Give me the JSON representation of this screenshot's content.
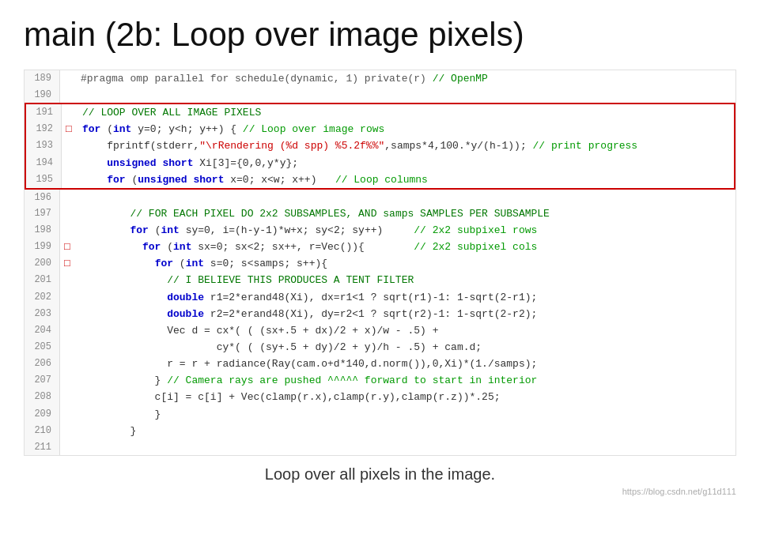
{
  "title": "main (2b: Loop over image pixels)",
  "lines": [
    {
      "num": "189",
      "marker": "",
      "content": "<span class='pragma'>#pragma omp parallel for schedule(dynamic, 1) private(r) // OpenMP</span>"
    },
    {
      "num": "190",
      "marker": "",
      "content": ""
    },
    {
      "num": "191",
      "marker": "",
      "content": "<span class='cap-comment'>// LOOP OVER ALL IMAGE PIXELS</span>",
      "boxTop": true
    },
    {
      "num": "192",
      "marker": "□",
      "content": "<span class='kw'>for</span> <span class='plain'>(</span><span class='kw'>int</span> <span class='plain'>y=0; y&lt;h; y++)</span> <span class='plain'>{ </span><span class='comment'>// Loop over image rows</span>"
    },
    {
      "num": "193",
      "marker": "",
      "content": "    <span class='plain'>fprintf(stderr,</span><span class='string'>&quot;\\rRendering (%d spp) %5.2f%%&quot;</span><span class='plain'>,samps*4,100.*y/(h-1)); </span><span class='comment'>// print progress</span>"
    },
    {
      "num": "194",
      "marker": "",
      "content": "    <span class='unsigned-kw'>unsigned short</span> <span class='plain'>Xi[3]={0,0,y*y};</span>"
    },
    {
      "num": "195",
      "marker": "",
      "content": "    <span class='kw'>for</span> <span class='plain'>(</span><span class='unsigned-kw'>unsigned short</span> <span class='plain'>x=0; x&lt;w; x++)</span>   <span class='comment'>// Loop columns</span>",
      "boxBottom": true
    },
    {
      "num": "196",
      "marker": "",
      "content": ""
    },
    {
      "num": "197",
      "marker": "",
      "content": "        <span class='cap-comment'>// FOR EACH PIXEL DO 2x2 SUBSAMPLES, AND samps SAMPLES PER SUBSAMPLE</span>"
    },
    {
      "num": "198",
      "marker": "",
      "content": "        <span class='kw'>for</span> <span class='plain'>(</span><span class='kw'>int</span> <span class='plain'>sy=0, i=(h-y-1)*w+x; sy&lt;2; sy++)</span>     <span class='comment'>// 2x2 subpixel rows</span>"
    },
    {
      "num": "199",
      "marker": "□",
      "content": "          <span class='kw'>for</span> <span class='plain'>(</span><span class='kw'>int</span> <span class='plain'>sx=0; sx&lt;2; sx++, r=Vec()){</span>        <span class='comment'>// 2x2 subpixel cols</span>"
    },
    {
      "num": "200",
      "marker": "□",
      "content": "            <span class='kw'>for</span> <span class='plain'>(</span><span class='kw'>int</span> <span class='plain'>s=0; s&lt;samps; s++){</span>"
    },
    {
      "num": "201",
      "marker": "",
      "content": "              <span class='cap-comment'>// I BELIEVE THIS PRODUCES A TENT FILTER</span>"
    },
    {
      "num": "202",
      "marker": "",
      "content": "              <span class='kw'>double</span> <span class='plain'>r1=2*erand48(Xi), dx=r1&lt;1 ? sqrt(r1)-1: 1-sqrt(2-r1);</span>"
    },
    {
      "num": "203",
      "marker": "",
      "content": "              <span class='kw'>double</span> <span class='plain'>r2=2*erand48(Xi), dy=r2&lt;1 ? sqrt(r2)-1: 1-sqrt(2-r2);</span>"
    },
    {
      "num": "204",
      "marker": "",
      "content": "              <span class='plain'>Vec d = cx*( ( (sx+.5 + dx)/2 + x)/w - .5) +</span>"
    },
    {
      "num": "205",
      "marker": "",
      "content": "                      <span class='plain'>cy*( ( (sy+.5 + dy)/2 + y)/h - .5) + cam.d;</span>"
    },
    {
      "num": "206",
      "marker": "",
      "content": "              <span class='plain'>r = r + radiance(Ray(cam.o+d*140,d.norm()),0,Xi)*(1./samps);</span>"
    },
    {
      "num": "207",
      "marker": "",
      "content": "            <span class='plain'>} </span><span class='comment'>// Camera rays are pushed ^^^^^ forward to start in interior</span>"
    },
    {
      "num": "208",
      "marker": "",
      "content": "            <span class='plain'>c[i] = c[i] + Vec(clamp(r.x),clamp(r.y),clamp(r.z))*.25;</span>"
    },
    {
      "num": "209",
      "marker": "",
      "content": "            <span class='plain'>}</span>"
    },
    {
      "num": "210",
      "marker": "",
      "content": "        <span class='plain'>}</span>"
    },
    {
      "num": "211",
      "marker": "",
      "content": ""
    }
  ],
  "caption": "Loop over all pixels in the image.",
  "watermark": "https://blog.csdn.net/g11d111"
}
